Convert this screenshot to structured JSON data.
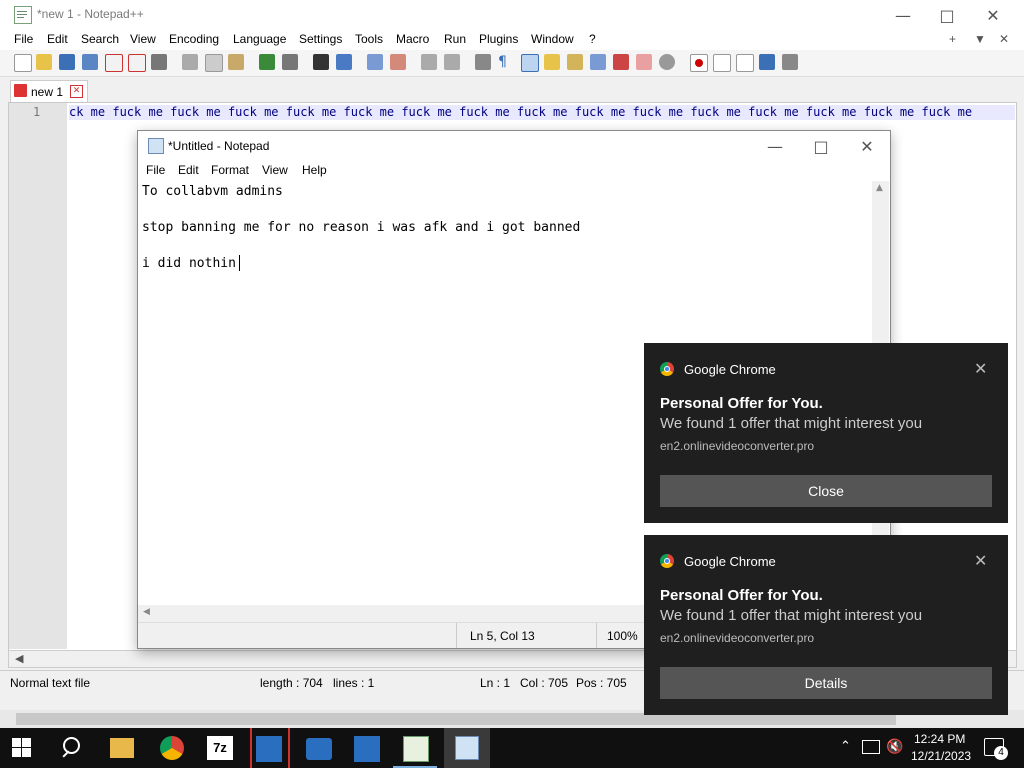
{
  "npp": {
    "title": "*new 1 - Notepad++",
    "menu": [
      "File",
      "Edit",
      "Search",
      "View",
      "Encoding",
      "Language",
      "Settings",
      "Tools",
      "Macro",
      "Run",
      "Plugins",
      "Window",
      "?"
    ],
    "tab_label": "new 1",
    "line_number": "1",
    "line1_text": "ck me fuck me fuck me fuck me fuck me fuck me fuck me fuck me fuck me fuck me fuck me fuck me fuck me fuck me fuck me fuck me",
    "status": {
      "type": "Normal text file",
      "length": "length : 704",
      "lines": "lines : 1",
      "ln": "Ln : 1",
      "col": "Col : 705",
      "pos": "Pos : 705"
    }
  },
  "notepad": {
    "title": "*Untitled - Notepad",
    "menu": [
      "File",
      "Edit",
      "Format",
      "View",
      "Help"
    ],
    "text": "To collabvm admins\n\nstop banning me for no reason i was afk and i got banned\n\ni did nothin",
    "status_pos": "Ln 5, Col 13",
    "status_zoom": "100%"
  },
  "toasts": [
    {
      "app": "Google Chrome",
      "title": "Personal Offer for You.",
      "body": "We found 1 offer that might interest you",
      "source": "en2.onlinevideoconverter.pro",
      "button": "Close"
    },
    {
      "app": "Google Chrome",
      "title": "Personal Offer for You.",
      "body": "We found 1 offer that might interest you",
      "source": "en2.onlinevideoconverter.pro",
      "button": "Details"
    }
  ],
  "taskbar": {
    "time": "12:24 PM",
    "date": "12/21/2023",
    "notification_count": "4"
  }
}
